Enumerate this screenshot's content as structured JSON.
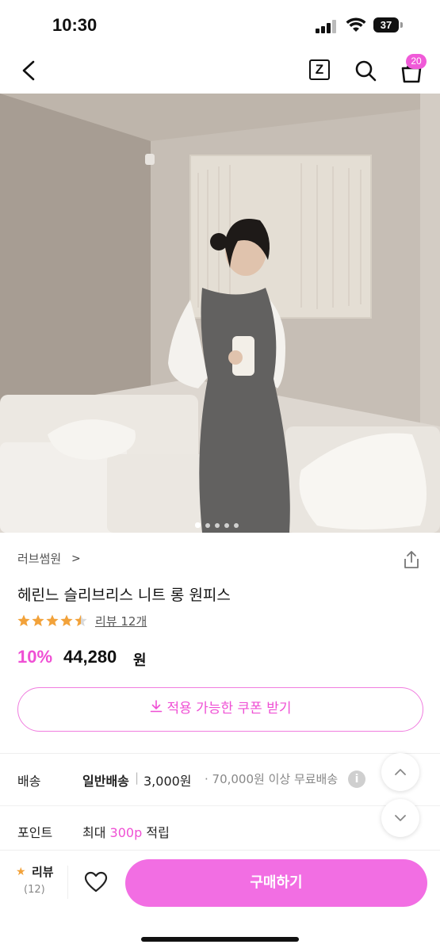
{
  "status_bar": {
    "time": "10:30",
    "battery": "37"
  },
  "nav": {
    "cart_count": "20"
  },
  "carousel": {
    "total_slides": 5,
    "current_slide": 1
  },
  "product": {
    "brand": "러브썸원",
    "brand_arrow": ">",
    "title": "헤린느 슬리브리스 니트 롱 원피스",
    "rating": 4.5,
    "review_link": "리뷰 12개",
    "discount": "10%",
    "price": "44,280",
    "price_unit": "원",
    "coupon_label": "적용 가능한 쿠폰 받기"
  },
  "shipping": {
    "label": "배송",
    "type": "일반배송",
    "separator": "|",
    "fee": "3,000원",
    "free_info": "· 70,000원 이상 무료배송",
    "info_icon": "i"
  },
  "points": {
    "label": "포인트",
    "prefix": "최대",
    "value": "300p",
    "suffix": "적립"
  },
  "bottom_bar": {
    "review_star": "★",
    "review_label": "리뷰",
    "review_count": "(12)",
    "buy_label": "구매하기"
  },
  "colors": {
    "accent": "#ef4fd4",
    "buy_button": "#f26ee3",
    "star": "#f2a23a"
  }
}
